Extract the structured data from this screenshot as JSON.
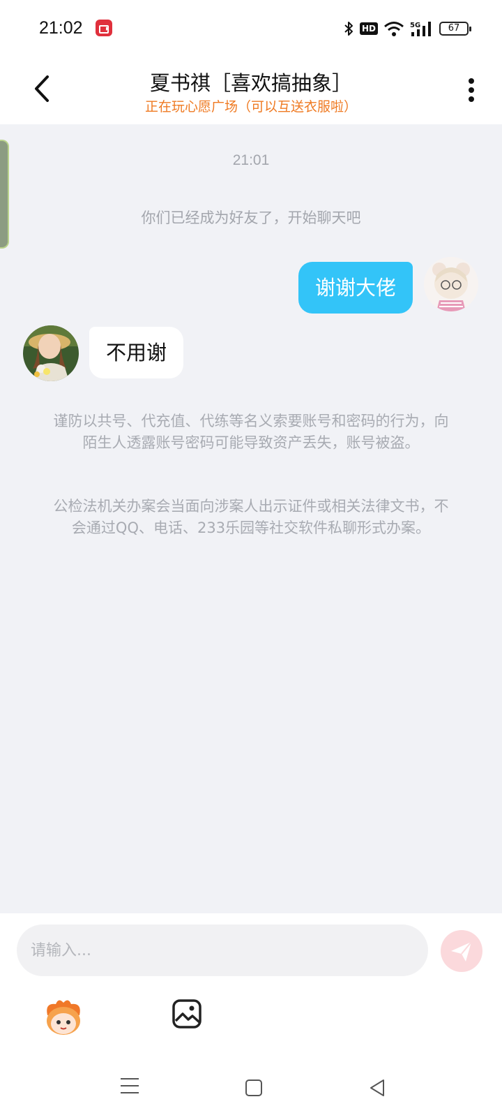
{
  "status_bar": {
    "time": "21:02",
    "icons": [
      "screen-record-icon",
      "bluetooth-icon",
      "hd-icon",
      "wifi-icon",
      "5g-signal-icon",
      "battery-icon"
    ],
    "hd_label": "HD",
    "battery_level": "67"
  },
  "header": {
    "title": "夏书祺［喜欢搞抽象］",
    "subtitle": "正在玩心愿广场（可以互送衣服啦）",
    "back_icon": "chevron-left-icon",
    "menu_icon": "more-vertical-icon"
  },
  "chat": {
    "timestamp": "21:01",
    "system_notice": "你们已经成为好友了，开始聊天吧",
    "messages": [
      {
        "sender": "me",
        "text": "谢谢大佬"
      },
      {
        "sender": "other",
        "text": "不用谢"
      }
    ],
    "warnings": [
      "谨防以共号、代充值、代练等名义索要账号和密码的行为，向陌生人透露账号密码可能导致资产丢失，账号被盗。",
      "公检法机关办案会当面向涉案人出示证件或相关法律文书，不会通过QQ、电话、233乐园等社交软件私聊形式办案。"
    ]
  },
  "input": {
    "placeholder": "请输入...",
    "value": "",
    "send_icon": "paper-plane-icon",
    "tools": [
      "mascot-emoji-icon",
      "image-icon"
    ]
  },
  "colors": {
    "my_bubble": "#33c4f8",
    "subtitle": "#ef7a22",
    "chat_background": "#f1f2f6",
    "send_button": "#fbd9dc"
  }
}
